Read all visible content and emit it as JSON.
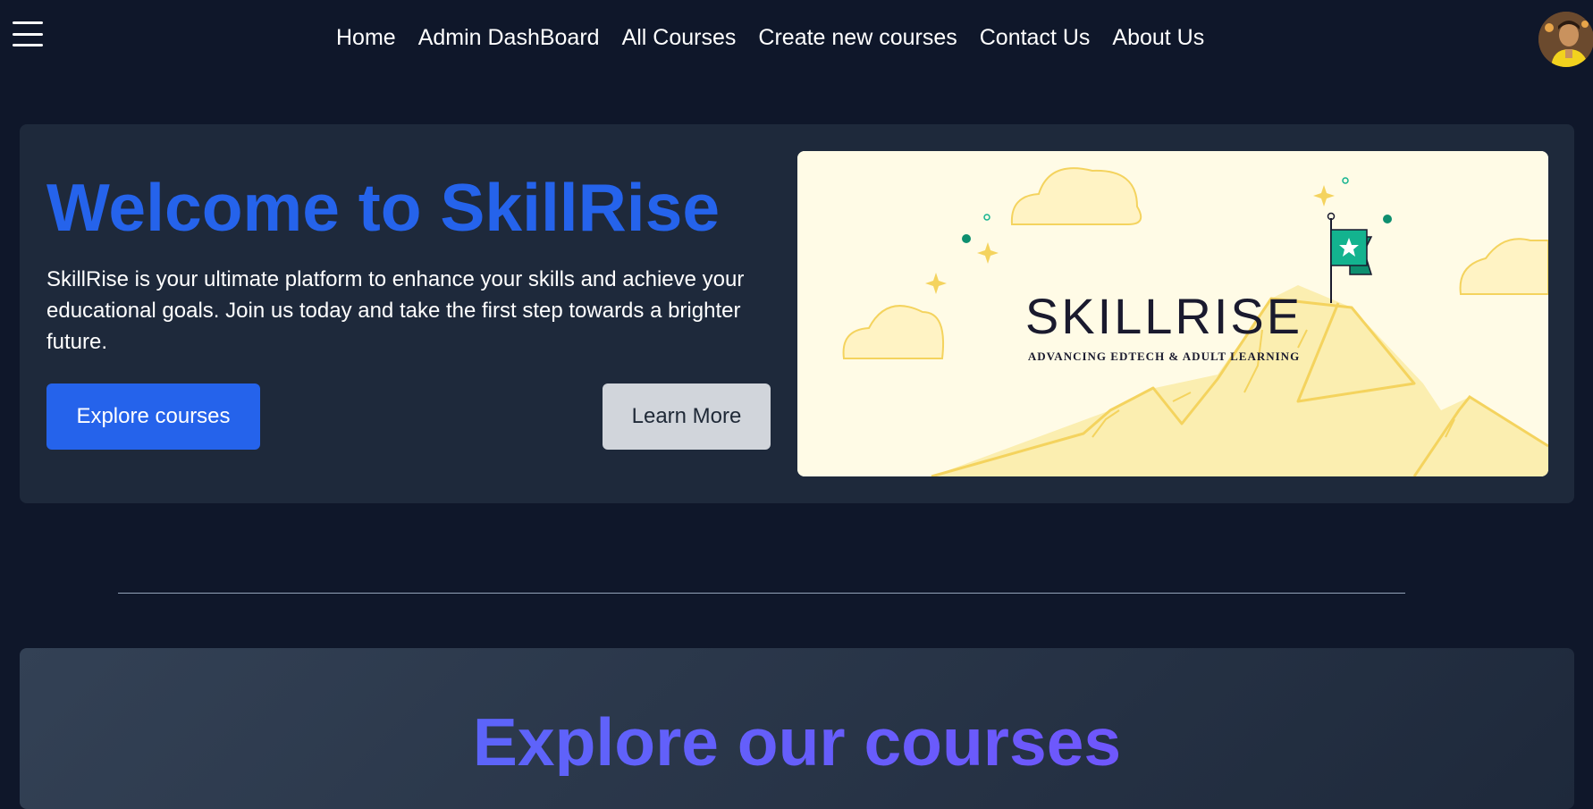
{
  "nav": {
    "links": [
      "Home",
      "Admin DashBoard",
      "All Courses",
      "Create new courses",
      "Contact Us",
      "About Us"
    ]
  },
  "hero": {
    "title": "Welcome to SkillRise",
    "description": "SkillRise is your ultimate platform to enhance your skills and achieve your educational goals. Join us today and take the first step towards a brighter future.",
    "explore_button": "Explore courses",
    "learn_more_button": "Learn More",
    "banner": {
      "logo_text": "SKILLRISE",
      "tagline": "ADVANCING EDTECH & ADULT LEARNING"
    }
  },
  "courses": {
    "title": "Explore our courses"
  },
  "colors": {
    "background": "#0f172a",
    "card": "#1e293b",
    "accent": "#2563eb",
    "banner_bg": "#fffbe6",
    "mountain": "#f9e79f",
    "flag": "#13b38f"
  },
  "icons": [
    "hamburger-menu-icon",
    "avatar",
    "star-icon",
    "flag-icon",
    "cloud-icon",
    "sparkle-icon"
  ]
}
